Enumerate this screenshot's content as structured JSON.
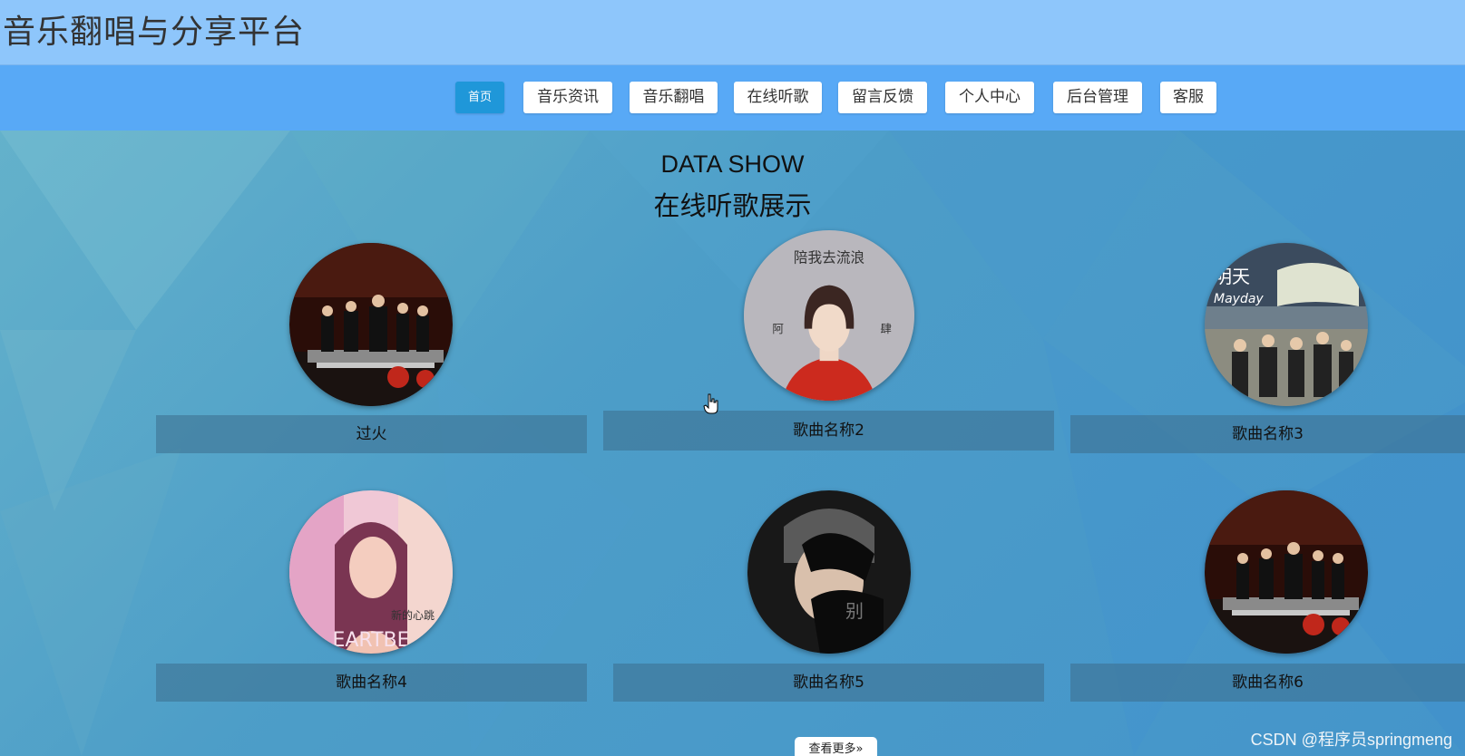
{
  "header": {
    "site_title": "音乐翻唱与分享平台"
  },
  "nav": {
    "items": [
      {
        "label": "首页",
        "active": true
      },
      {
        "label": "音乐资讯"
      },
      {
        "label": "音乐翻唱"
      },
      {
        "label": "在线听歌"
      },
      {
        "label": "留言反馈"
      },
      {
        "label": "个人中心"
      },
      {
        "label": "后台管理"
      },
      {
        "label": "客服"
      }
    ]
  },
  "section": {
    "title_en": "DATA SHOW",
    "title_cn": "在线听歌展示",
    "songs": [
      {
        "name": "过火",
        "cover": "orchestra-photo"
      },
      {
        "name": "歌曲名称2",
        "cover": "girl-red-sweater",
        "cover_text": "陪我去流浪"
      },
      {
        "name": "歌曲名称3",
        "cover": "mayday-band",
        "cover_text": "Mayday"
      },
      {
        "name": "歌曲名称4",
        "cover": "woman-pink-portrait",
        "cover_text": "EARTBE"
      },
      {
        "name": "歌曲名称5",
        "cover": "man-black-gloves",
        "cover_text": "别"
      },
      {
        "name": "歌曲名称6",
        "cover": "orchestra-photo"
      }
    ],
    "more_label": "查看更多»"
  },
  "watermark": "CSDN @程序员springmeng",
  "colors": {
    "header_bg": "#8ec6fb",
    "nav_bg": "#58a9f6",
    "nav_active": "#1f97d9",
    "main_bg": "#4b9cc8"
  }
}
